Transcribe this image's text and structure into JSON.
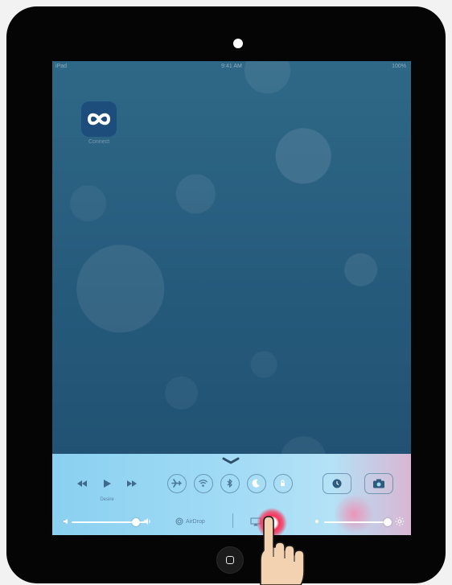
{
  "statusbar": {
    "carrier": "iPad",
    "time": "9:41 AM",
    "battery": "100%"
  },
  "home_app": {
    "label": "Connect",
    "icon": "infinity-icon"
  },
  "control_center": {
    "media": {
      "previous_icon": "rewind-icon",
      "play_icon": "play-icon",
      "next_icon": "fast-forward-icon",
      "label": "Desire"
    },
    "toggles": [
      {
        "name": "airplane-mode",
        "icon": "airplane-icon"
      },
      {
        "name": "wifi",
        "icon": "wifi-icon"
      },
      {
        "name": "bluetooth",
        "icon": "bluetooth-icon"
      },
      {
        "name": "do-not-disturb",
        "icon": "moon-icon"
      },
      {
        "name": "rotation-lock",
        "icon": "lock-rotation-icon"
      }
    ],
    "tools": [
      {
        "name": "clock",
        "icon": "clock-icon"
      },
      {
        "name": "camera",
        "icon": "camera-icon"
      }
    ],
    "volume_level": 0.88,
    "brightness_level": 0.92,
    "airdrop_label": "AirDrop",
    "airplay_icon": "airplay-icon"
  },
  "colors": {
    "accent_highlight": "#ff2850",
    "cc_icon": "#5a83a3"
  }
}
